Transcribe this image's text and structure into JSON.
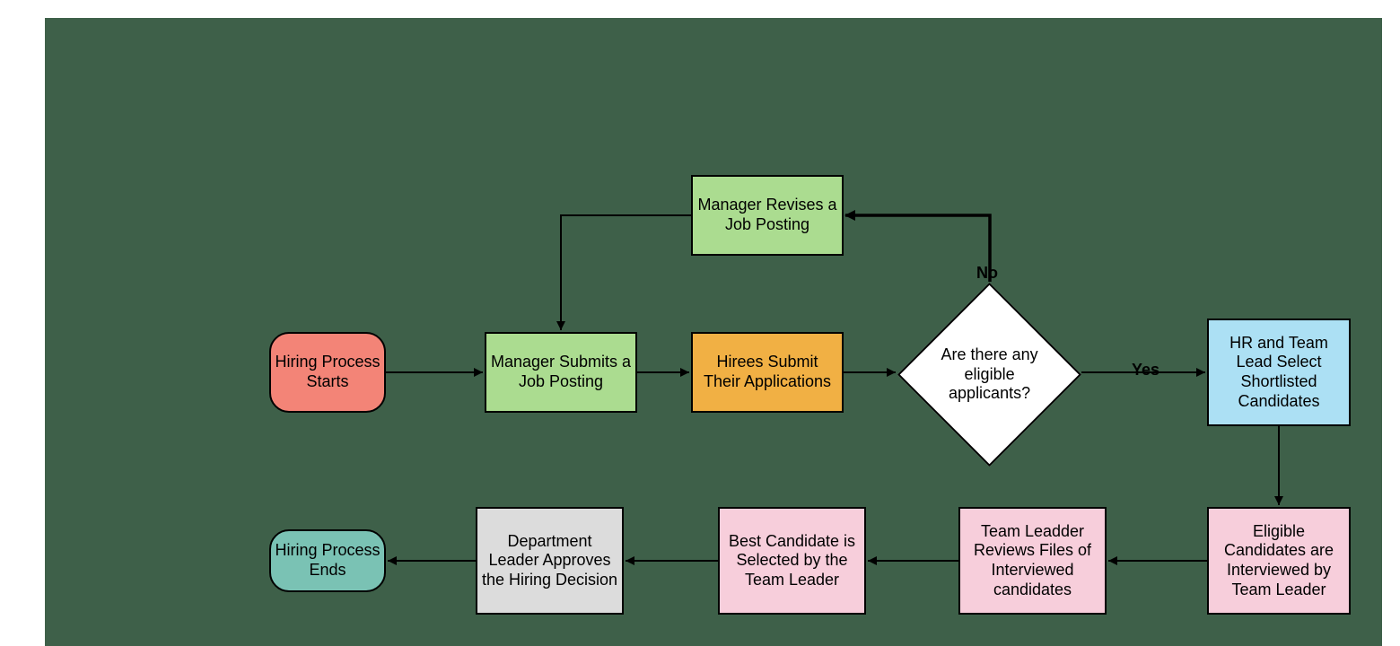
{
  "diagram": {
    "type": "flowchart",
    "process": "Hiring Process",
    "nodes": {
      "start": "Hiring Process Starts",
      "submit": "Manager Submits a Job Posting",
      "revise": "Manager Revises a Job Posting",
      "hirees": "Hirees Submit Their Applications",
      "decision": "Are there any eligible applicants?",
      "shortlist": "HR and Team Lead Select Shortlisted Candidates",
      "interview": "Eligible Candidates are Interviewed by Team Leader",
      "review": "Team Leadder Reviews  Files of Interviewed candidates",
      "select": "Best Candidate is Selected by the Team Leader",
      "approve": "Department Leader Approves the Hiring Decision",
      "end": "Hiring Process Ends"
    },
    "edges": {
      "yes": "Yes",
      "no": "No"
    }
  }
}
